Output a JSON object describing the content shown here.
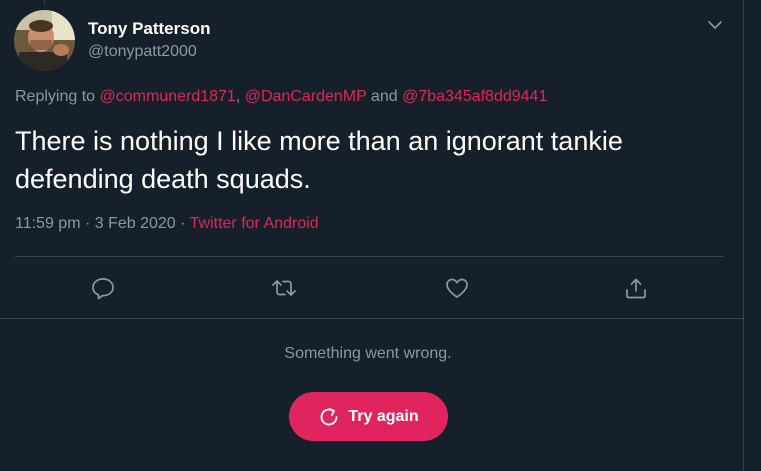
{
  "tweet": {
    "author_name": "Tony Patterson",
    "author_handle": "@tonypatt2000",
    "replying_prefix": "Replying to ",
    "mentions": [
      "@communerd1871",
      "@DanCardenMP",
      "@7ba345af8dd9441"
    ],
    "mention_separator": ", ",
    "mention_and": " and ",
    "text": "There is nothing I like more than an ignorant tankie defending death squads.",
    "time": "11:59 pm",
    "date": "3 Feb 2020",
    "dot": " · ",
    "source": "Twitter for Android"
  },
  "actions": {
    "icons": [
      "reply-icon",
      "retweet-icon",
      "like-icon",
      "share-icon"
    ]
  },
  "error": {
    "message": "Something went wrong.",
    "retry_label": "Try again"
  },
  "colors": {
    "background": "#15202b",
    "accent": "#e0245e",
    "secondary_text": "#8899a6",
    "border": "#38444d"
  }
}
